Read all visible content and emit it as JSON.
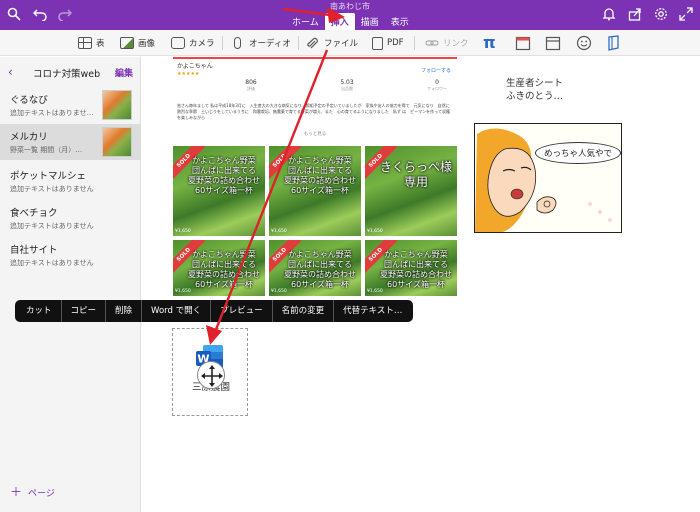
{
  "window": {
    "title": "南あわじ市"
  },
  "toolbar_left": {
    "search_icon": "search-icon",
    "undo_icon": "undo-icon",
    "redo_icon": "redo-icon"
  },
  "tabs": [
    {
      "label": "ホーム"
    },
    {
      "label": "挿入",
      "active": true
    },
    {
      "label": "描画"
    },
    {
      "label": "表示"
    }
  ],
  "toolbar_right": {
    "icons": [
      "bell-icon",
      "share-icon",
      "gear-icon",
      "expand-icon"
    ]
  },
  "ribbon": {
    "table": "表",
    "image": "画像",
    "camera": "カメラ",
    "audio": "オーディオ",
    "file": "ファイル",
    "pdf": "PDF",
    "link": "リンク"
  },
  "sidebar": {
    "notebook": "コロナ対策web",
    "edit": "編集",
    "pages": [
      {
        "title": "ぐるなび",
        "sub": "追加テキストはありませ…",
        "thumb": true
      },
      {
        "title": "メルカリ",
        "sub": "野菜一覧 期間（月）…",
        "thumb": true,
        "selected": true
      },
      {
        "title": "ポケットマルシェ",
        "sub": "追加テキストはありません"
      },
      {
        "title": "食べチョク",
        "sub": "追加テキストはありません"
      },
      {
        "title": "自社サイト",
        "sub": "追加テキストはありません"
      }
    ],
    "add_page": "ページ"
  },
  "clip": {
    "name": "かよこちゃん",
    "stars": "★★★★★",
    "stats": [
      {
        "value": "806",
        "label": "評価"
      },
      {
        "value": "5.03",
        "label": "出品数"
      },
      {
        "value": "0",
        "label": "フォロワー"
      }
    ],
    "follow": "フォローする",
    "text": "皆さん毎年まして 私は平成18年3月に　入生産大の大きな病気になり　際組予定の予定いていましたが　家族や友人の協力を得て　元気になり　自然に熱烈な季節　土いじりをしているうちに　和農栽培、無農薬で育てる野菜が増え、また　心の育てるようになりました　私ず は　ピーマンを作って収穫を楽しみながら",
    "more": "もっと見る",
    "tiles": [
      {
        "sold": "SOLD",
        "text": "かよこちゃん野菜 団んぱに出来てる 夏野菜の詰め合わせ 60サイズ箱一杯",
        "price": "¥1,650"
      },
      {
        "sold": "SOLD",
        "text": "かよこちゃん野菜 団んぱに出来てる 夏野菜の詰め合わせ 60サイズ箱一杯",
        "price": "¥1,650"
      },
      {
        "sold": "SOLD",
        "text": "きくらっぺ様 専用",
        "price": "¥1,650"
      },
      {
        "sold": "SOLD",
        "text": "かよこちゃん野菜 団んぱに出来てる 夏野菜の詰め合わせ 60サイズ箱一杯",
        "price": "¥1,650"
      },
      {
        "sold": "SOLD",
        "text": "かよこちゃん野菜 団んぱに出来てる 夏野菜の詰め合わせ 60サイズ箱一杯",
        "price": "¥1,650"
      },
      {
        "sold": "SOLD",
        "text": "かよこちゃん野菜 団んぱに出来てる 夏野菜の詰め合わせ 60サイズ箱一杯",
        "price": "¥1,650"
      }
    ]
  },
  "note": {
    "line1": "生産者シート",
    "line2": "ふきのとう…"
  },
  "comic": {
    "bubble": "めっちゃ人気やで"
  },
  "context_menu": [
    "カット",
    "コピー",
    "削除",
    "Word で開く",
    "プレビュー",
    "名前の変更",
    "代替テキスト…"
  ],
  "attachment": {
    "name": "三原農園",
    "icon": "word-icon"
  },
  "colors": {
    "accent": "#7b33b3",
    "arrow": "#e0202a"
  }
}
